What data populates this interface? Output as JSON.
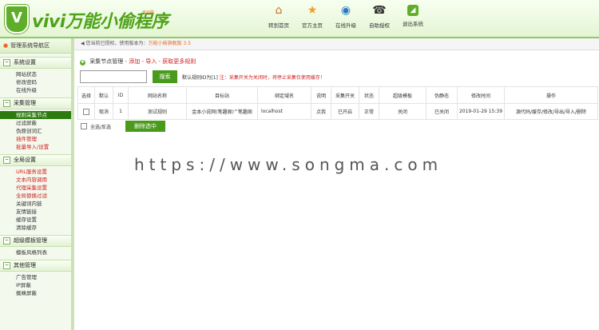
{
  "header": {
    "logo_letter": "V",
    "app_title": "vivi万能小偷程序",
    "tag": "全功能",
    "nav": [
      {
        "label": "转到首页",
        "icon": "home-icon"
      },
      {
        "label": "官方主页",
        "icon": "star-icon"
      },
      {
        "label": "在线升级",
        "icon": "globe-icon"
      },
      {
        "label": "自助授权",
        "icon": "phone-icon"
      },
      {
        "label": "退出系统",
        "icon": "rss-icon"
      }
    ]
  },
  "sidebar": {
    "title": "管理系统导航区",
    "groups": [
      {
        "label": "系统设置",
        "items": [
          {
            "label": "网站状态"
          },
          {
            "label": "修改密码"
          },
          {
            "label": "在线升级"
          }
        ]
      },
      {
        "label": "采集管理",
        "items": [
          {
            "label": "规则采集节点",
            "active": true
          },
          {
            "label": "过滤屏蔽"
          },
          {
            "label": "伪原创词汇"
          },
          {
            "label": "插件管理",
            "red": true
          },
          {
            "label": "批量导入/设置",
            "red": true
          }
        ]
      },
      {
        "label": "全局设置",
        "items": [
          {
            "label": "URL服务设置",
            "red": true
          },
          {
            "label": "文本内容调用",
            "red": true
          },
          {
            "label": "代理采集设置",
            "red": true
          },
          {
            "label": "全局替换过滤",
            "red": true
          },
          {
            "label": "关键词内链"
          },
          {
            "label": "友情链接"
          },
          {
            "label": "缓存设置"
          },
          {
            "label": "清除缓存"
          }
        ]
      },
      {
        "label": "超级模板管理",
        "items": [
          {
            "label": "模板风格列表"
          }
        ]
      },
      {
        "label": "其他管理",
        "items": [
          {
            "label": "广告管理"
          },
          {
            "label": "IP屏蔽"
          },
          {
            "label": "蜘蛛屏蔽"
          }
        ]
      }
    ]
  },
  "notice": {
    "prefix": "您当前已授权，使用版本为：",
    "version": "万能小偷旗舰版 3.5"
  },
  "page_title": {
    "text": "采集节点管理",
    "add": "- 添加",
    "import": "- 导入",
    "more": "- 获取更多规则"
  },
  "search": {
    "value": "",
    "button": "搜索",
    "tip_prefix": "默认规则ID为[1]",
    "tip_red": "注：采集开关为关闭时，将停止采集仅使用缓存！"
  },
  "table": {
    "headers": [
      "选择",
      "默认",
      "ID",
      "网站名称",
      "目标站",
      "绑定域名",
      "说明",
      "采集开关",
      "状态",
      "超级模板",
      "伪静态",
      "修改时间",
      "操作"
    ],
    "rows": [
      {
        "default": "取消",
        "id": "1",
        "name": "测试规则",
        "target": "金本小说网(笔趣阁)^笔趣阁",
        "domain": "localhost",
        "desc": "点我",
        "switch": "已开启",
        "status": "正常",
        "tpl": "关闭",
        "rewrite": "已关闭",
        "time": "2019-01-29 15:39",
        "ops": "源代码/缓存/修改/导出/导入/删除"
      }
    ]
  },
  "bottom": {
    "select_all": "全选/反选",
    "delete": "删除选中"
  },
  "watermark": "https://www.songma.com"
}
